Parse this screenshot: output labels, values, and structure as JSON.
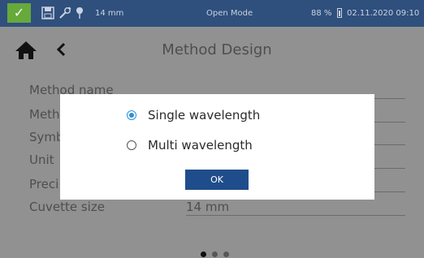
{
  "status_bar": {
    "path_length": "14 mm",
    "mode": "Open Mode",
    "battery": "88 %",
    "datetime": "02.11.2020 09:10",
    "check_icon": "check-icon",
    "icons": [
      "save-icon",
      "tools-icon",
      "pin-icon"
    ]
  },
  "header": {
    "title": "Method Design",
    "home_icon": "home-icon",
    "back_icon": "back-arrow-icon"
  },
  "form": {
    "fields": [
      {
        "label": "Method name",
        "value": ""
      },
      {
        "label": "Meth",
        "value": ""
      },
      {
        "label": "Symb",
        "value": ""
      },
      {
        "label": "Unit",
        "value": ""
      },
      {
        "label": "Preci",
        "value": ""
      },
      {
        "label": "Cuvette size",
        "value": "14 mm"
      }
    ]
  },
  "dialog": {
    "options": [
      {
        "label": "Single wavelength",
        "selected": true
      },
      {
        "label": "Multi wavelength",
        "selected": false
      }
    ],
    "ok_label": "OK"
  },
  "pagination": {
    "pages": 3,
    "current": 1
  },
  "colors": {
    "status_bar": "#2f4f7d",
    "status_ok": "#67a93b",
    "accent": "#2a8fd8",
    "button": "#1f4d8b"
  }
}
